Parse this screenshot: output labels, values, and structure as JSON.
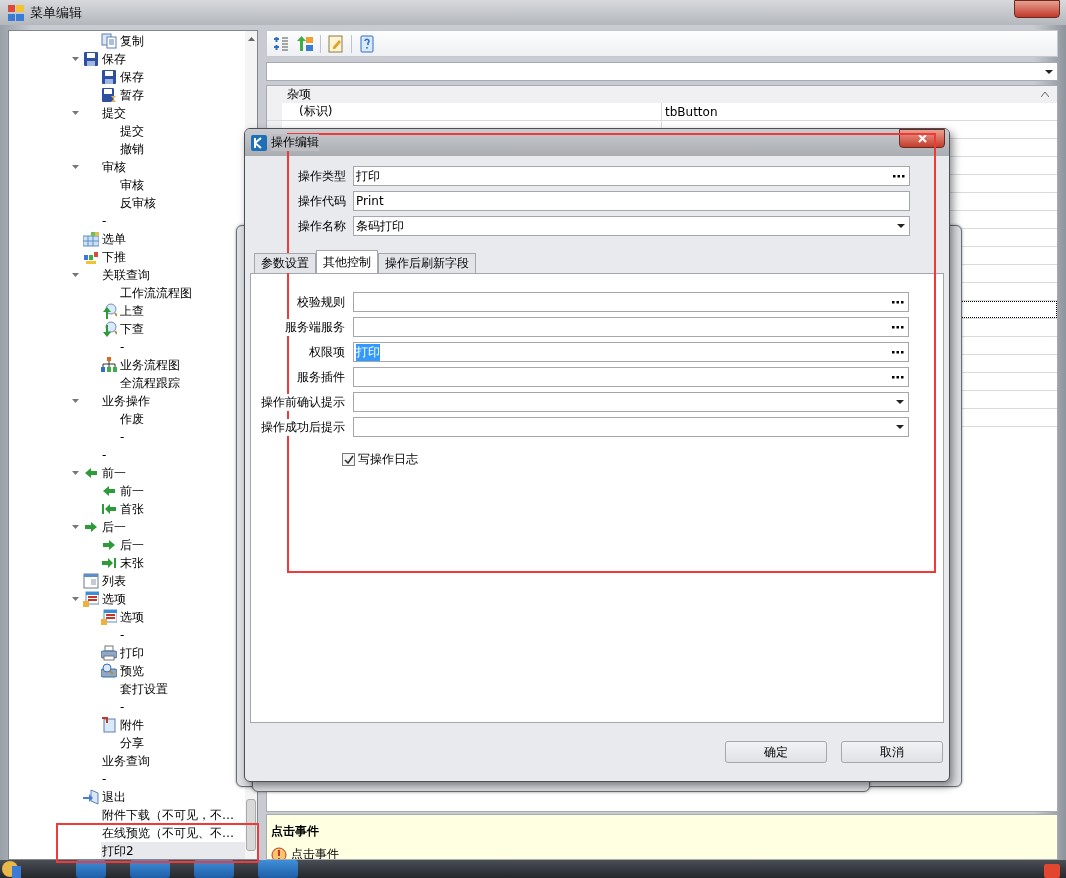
{
  "window": {
    "title": "菜单编辑"
  },
  "tree": {
    "items": [
      {
        "children": [
          {
            "label": "复制",
            "kind": "copy",
            "selected": false
          }
        ]
      },
      {
        "label": "保存",
        "kind": "save",
        "expanded": true,
        "selected": false,
        "children": [
          {
            "label": "保存",
            "kind": "save",
            "selected": false
          },
          {
            "label": "暂存",
            "kind": "save-temp",
            "selected": false
          }
        ]
      },
      {
        "label": "提交",
        "expanded": true,
        "selected": false,
        "children": [
          {
            "label": "提交",
            "selected": false
          },
          {
            "label": "撤销",
            "selected": false
          }
        ]
      },
      {
        "label": "审核",
        "expanded": true,
        "selected": false,
        "children": [
          {
            "label": "审核",
            "selected": false
          },
          {
            "label": "反审核",
            "selected": false
          }
        ]
      },
      {
        "label": "-",
        "selected": false
      },
      {
        "label": "选单",
        "kind": "grid",
        "selected": false
      },
      {
        "label": "下推",
        "kind": "push",
        "selected": false
      },
      {
        "label": "关联查询",
        "expanded": true,
        "selected": false,
        "children": [
          {
            "label": "工作流流程图",
            "selected": false
          },
          {
            "label": "上查",
            "kind": "search-up",
            "selected": false
          },
          {
            "label": "下查",
            "kind": "search-down",
            "selected": false
          },
          {
            "label": "-",
            "selected": false
          },
          {
            "label": "业务流程图",
            "kind": "hierarchy",
            "selected": false
          },
          {
            "label": "全流程跟踪",
            "selected": false
          }
        ]
      },
      {
        "label": "业务操作",
        "expanded": true,
        "selected": false,
        "children": [
          {
            "label": "作废",
            "selected": false
          },
          {
            "label": "-",
            "selected": false
          }
        ]
      },
      {
        "label": "-",
        "selected": false
      },
      {
        "label": "前一",
        "kind": "arrow-left",
        "expanded": true,
        "selected": false,
        "children": [
          {
            "label": "前一",
            "kind": "arrow-left",
            "selected": false
          },
          {
            "label": "首张",
            "kind": "arrow-first",
            "selected": false
          }
        ]
      },
      {
        "label": "后一",
        "kind": "arrow-right",
        "expanded": true,
        "selected": false,
        "children": [
          {
            "label": "后一",
            "kind": "arrow-right",
            "selected": false
          },
          {
            "label": "末张",
            "kind": "arrow-last",
            "selected": false
          }
        ]
      },
      {
        "label": "列表",
        "kind": "list",
        "selected": false
      },
      {
        "label": "选项",
        "kind": "calendar",
        "expanded": true,
        "selected": false,
        "children": [
          {
            "label": "选项",
            "kind": "calendar",
            "selected": false
          },
          {
            "label": "-",
            "selected": false
          },
          {
            "label": "打印",
            "kind": "printer",
            "selected": false
          },
          {
            "label": "预览",
            "kind": "preview",
            "selected": false
          },
          {
            "label": "套打设置",
            "selected": false
          },
          {
            "label": "-",
            "selected": false
          },
          {
            "label": "附件",
            "kind": "document",
            "selected": false
          },
          {
            "label": "分享",
            "selected": false
          }
        ]
      },
      {
        "label": "业务查询",
        "selected": false
      },
      {
        "label": "-",
        "selected": false
      },
      {
        "label": "退出",
        "kind": "exit",
        "selected": false
      },
      {
        "label": "附件下载（不可见，不…",
        "selected": false
      },
      {
        "label": "在线预览（不可见、不…",
        "selected": false
      },
      {
        "label": "打印2",
        "selected": true
      }
    ]
  },
  "property_grid": {
    "category": "杂项",
    "expanded": true,
    "rows": [
      {
        "label": "(标识)",
        "value": "tbButton",
        "selected": false
      },
      {
        "selected": false
      },
      {
        "selected": false
      },
      {
        "selected": false
      },
      {
        "selected": false
      },
      {
        "selected": false
      },
      {
        "selected": false
      },
      {
        "selected": false
      },
      {
        "selected": false
      },
      {
        "selected": false
      },
      {
        "selected": false
      },
      {
        "selected": true
      },
      {
        "selected": false
      },
      {
        "selected": false
      },
      {
        "selected": false
      },
      {
        "selected": false
      },
      {
        "selected": false
      },
      {
        "selected": false
      }
    ]
  },
  "description": {
    "title": "点击事件",
    "text": "点击事件"
  },
  "dialog": {
    "title": "操作编辑",
    "fields": [
      {
        "label": "操作类型",
        "value": "打印",
        "kind": "ellipsis"
      },
      {
        "label": "操作代码",
        "value": "Print",
        "kind": "text"
      },
      {
        "label": "操作名称",
        "value": "条码打印",
        "kind": "dropdown"
      }
    ],
    "tabs": [
      {
        "label": "参数设置",
        "selected": false
      },
      {
        "label": "其他控制",
        "selected": true
      },
      {
        "label": "操作后刷新字段",
        "selected": false
      }
    ],
    "controls": [
      {
        "label": "校验规则",
        "kind": "ellipsis"
      },
      {
        "label": "服务端服务",
        "kind": "ellipsis"
      },
      {
        "label": "权限项",
        "value": "打印",
        "kind": "ellipsis",
        "value_selected": true
      },
      {
        "label": "服务插件",
        "kind": "ellipsis"
      },
      {
        "label": "操作前确认提示",
        "kind": "dropdown"
      },
      {
        "label": "操作成功后提示",
        "kind": "dropdown"
      }
    ],
    "checkbox": {
      "label": "写操作日志",
      "checked": true
    },
    "buttons": [
      "确定",
      "取消"
    ]
  }
}
